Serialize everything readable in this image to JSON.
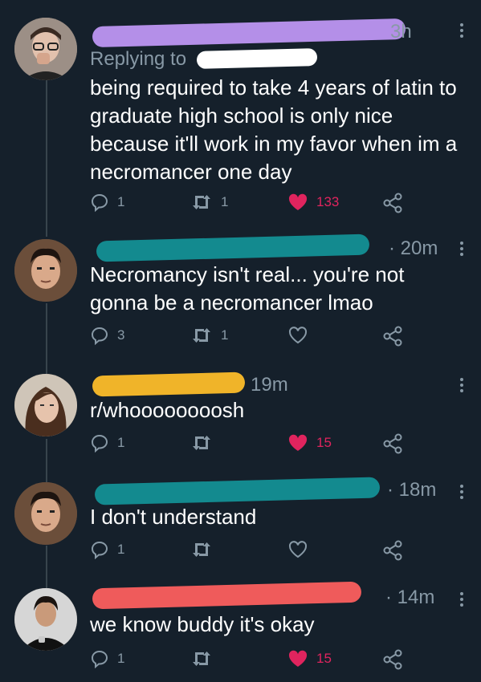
{
  "thread": [
    {
      "replying_to": "Replying to",
      "time": "3h",
      "text": "being required to take 4 years of latin to graduate high school is only nice because it'll work in my favor when im a necromancer one day",
      "reply_count": "1",
      "retweet_count": "1",
      "like_count": "133",
      "liked": true,
      "redaction_color": "#b48fe8"
    },
    {
      "time": "· 20m",
      "text": "Necromancy isn't real... you're not gonna be a necromancer lmao",
      "reply_count": "3",
      "retweet_count": "1",
      "like_count": "",
      "liked": false,
      "redaction_color": "#138a8f"
    },
    {
      "time": "19m",
      "text": "r/whoooooooosh",
      "reply_count": "1",
      "retweet_count": "",
      "like_count": "15",
      "liked": true,
      "redaction_color": "#f0b429"
    },
    {
      "time": "· 18m",
      "text": "I don't understand",
      "reply_count": "1",
      "retweet_count": "",
      "like_count": "",
      "liked": false,
      "redaction_color": "#138a8f"
    },
    {
      "time": "· 14m",
      "text": "we know buddy it's okay",
      "reply_count": "1",
      "retweet_count": "",
      "like_count": "15",
      "liked": true,
      "redaction_color": "#ef5b5b"
    }
  ],
  "colors": {
    "background": "#15202b",
    "muted": "#8899a6",
    "like": "#e0245e",
    "thread_line": "#38444d"
  }
}
